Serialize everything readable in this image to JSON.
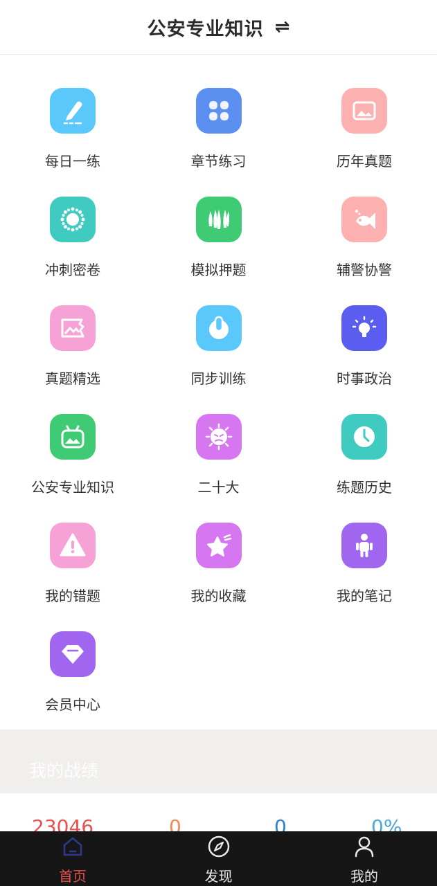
{
  "header": {
    "title": "公安专业知识",
    "switch_icon": "⇌"
  },
  "menu": [
    {
      "label": "每日一练",
      "icon": "pencil-icon",
      "color": "#5ac8fa"
    },
    {
      "label": "章节练习",
      "icon": "grid-icon",
      "color": "#5b8ff0"
    },
    {
      "label": "历年真题",
      "icon": "image-icon",
      "color": "#fdb0b0"
    },
    {
      "label": "冲刺密卷",
      "icon": "sun-icon",
      "color": "#3fcbbf"
    },
    {
      "label": "模拟押题",
      "icon": "forest-icon",
      "color": "#3fcb74"
    },
    {
      "label": "辅警协警",
      "icon": "fish-icon",
      "color": "#fdb0b0"
    },
    {
      "label": "真题精选",
      "icon": "picture-icon",
      "color": "#f7a2d6"
    },
    {
      "label": "同步训练",
      "icon": "power-icon",
      "color": "#5ac8fa"
    },
    {
      "label": "时事政治",
      "icon": "bulb-icon",
      "color": "#5b5cf0"
    },
    {
      "label": "公安专业知识",
      "icon": "tv-icon",
      "color": "#3fcb74"
    },
    {
      "label": "二十大",
      "icon": "virus-icon",
      "color": "#d676f0"
    },
    {
      "label": "练题历史",
      "icon": "clock-icon",
      "color": "#3fcbbf"
    },
    {
      "label": "我的错题",
      "icon": "warning-icon",
      "color": "#f7a2d6"
    },
    {
      "label": "我的收藏",
      "icon": "star-icon",
      "color": "#d676f0"
    },
    {
      "label": "我的笔记",
      "icon": "person-icon",
      "color": "#a066f0"
    },
    {
      "label": "会员中心",
      "icon": "diamond-icon",
      "color": "#a066f0"
    }
  ],
  "stats": {
    "title": "我的战绩",
    "values": [
      "23046",
      "0",
      "0",
      "0%"
    ]
  },
  "tabs": [
    {
      "label": "首页",
      "icon": "home-icon",
      "active": true
    },
    {
      "label": "发现",
      "icon": "compass-icon",
      "active": false
    },
    {
      "label": "我的",
      "icon": "user-icon",
      "active": false
    }
  ],
  "colors": {
    "accent": "#e8514f",
    "tabbar_bg": "#161616"
  }
}
